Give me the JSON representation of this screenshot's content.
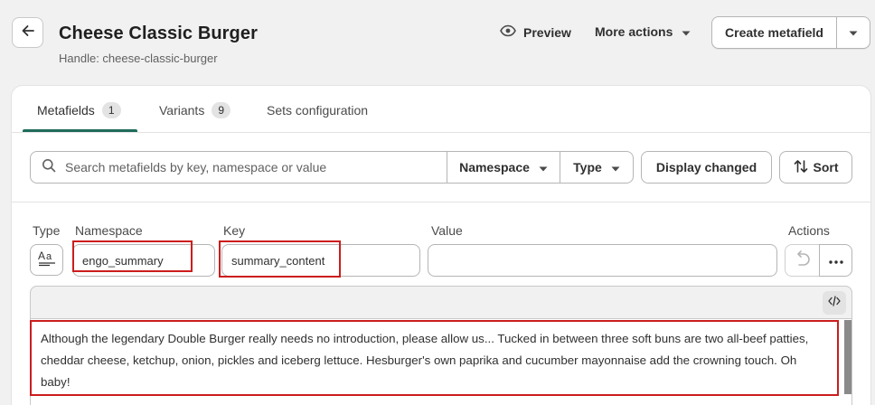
{
  "header": {
    "title": "Cheese Classic Burger",
    "handle": "Handle: cheese-classic-burger",
    "preview_label": "Preview",
    "more_actions_label": "More actions",
    "create_label": "Create metafield"
  },
  "tabs": [
    {
      "label": "Metafields",
      "count": "1"
    },
    {
      "label": "Variants",
      "count": "9"
    },
    {
      "label": "Sets configuration"
    }
  ],
  "filters": {
    "search_placeholder": "Search metafields by key, namespace or value",
    "namespace_label": "Namespace",
    "type_label": "Type",
    "display_changed_label": "Display changed",
    "sort_label": "Sort"
  },
  "columns": {
    "type": "Type",
    "namespace": "Namespace",
    "key": "Key",
    "value": "Value",
    "actions": "Actions"
  },
  "row": {
    "namespace": "engo_summary",
    "key": "summary_content",
    "value": "",
    "type_icon": "text-icon",
    "content": "Although the legendary Double Burger really needs no introduction, please allow us... Tucked in between three soft buns are two all-beef patties, cheddar cheese, ketchup, onion, pickles and iceberg lettuce. Hesburger's own paprika and cucumber mayonnaise add the crowning touch. Oh baby!"
  },
  "colors": {
    "highlight": "#cc1d1d",
    "tab_underline": "#1f6b5a",
    "background": "#f1f1f1"
  }
}
